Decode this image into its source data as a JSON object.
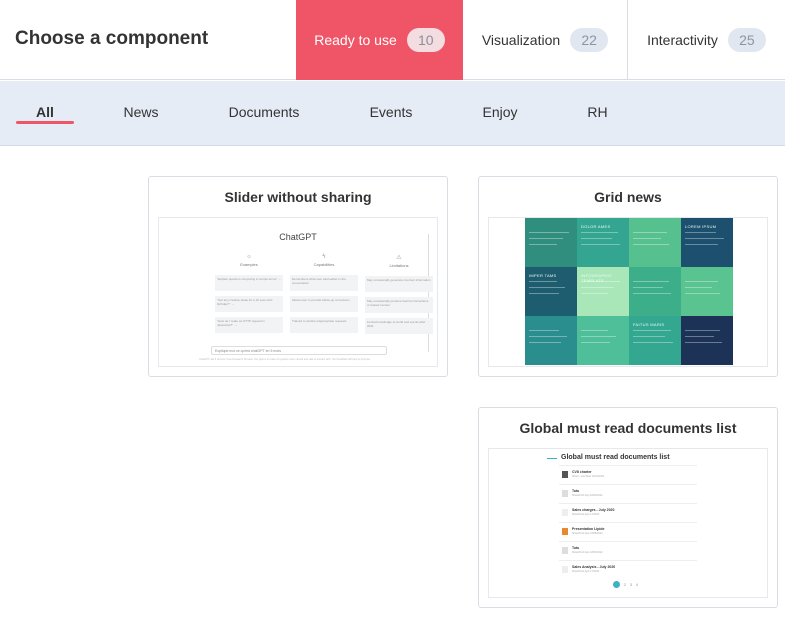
{
  "header": {
    "title": "Choose a component",
    "tabs": [
      {
        "label": "Ready to use",
        "count": "10",
        "active": true
      },
      {
        "label": "Visualization",
        "count": "22",
        "active": false
      },
      {
        "label": "Interactivity",
        "count": "25",
        "active": false
      }
    ]
  },
  "filters": [
    {
      "label": "All",
      "active": true
    },
    {
      "label": "News",
      "active": false
    },
    {
      "label": "Documents",
      "active": false
    },
    {
      "label": "Events",
      "active": false
    },
    {
      "label": "Enjoy",
      "active": false
    },
    {
      "label": "RH",
      "active": false
    }
  ],
  "cards": [
    {
      "title": "Slider without sharing",
      "preview": {
        "app_title": "ChatGPT",
        "columns": [
          {
            "heading": "Examples",
            "icon": "sun-icon",
            "items": [
              "\"Explain quantum computing in simple terms\" →",
              "\"Got any creative ideas for a 10 year old's birthday?\" →",
              "\"How do I make an HTTP request in Javascript?\" →"
            ]
          },
          {
            "heading": "Capabilities",
            "icon": "lightning-icon",
            "items": [
              "Remembers what user said earlier in the conversation",
              "Allows user to provide follow-up corrections",
              "Trained to decline inappropriate requests"
            ]
          },
          {
            "heading": "Limitations",
            "icon": "warning-icon",
            "items": [
              "May occasionally generate incorrect information",
              "May occasionally produce harmful instructions or biased content",
              "Limited knowledge of world and events after 2021"
            ]
          }
        ],
        "input_text": "Explique moi ce qu'est chatGPT en 5 mots",
        "footer": "ChatGPT Jan 9 Version. Free Research Preview. Our goal is to make AI systems more natural and safe to interact with. Your feedback will help us improve."
      }
    },
    {
      "title": "Grid news",
      "preview": {
        "tiles": [
          "",
          "DOLOR AMES",
          "",
          "LOREM IPSUM",
          "IMPER TAMS",
          "INFOGRAPHIC TEMPLATE",
          "",
          "",
          "",
          "",
          "FAITUS MARIS",
          ""
        ],
        "tile_colors": [
          "#2f8e7e",
          "#34a590",
          "#56c08f",
          "#1d4f6e",
          "#1e5c70",
          "#a9e6b8",
          "#3cae8a",
          "#59c48f",
          "#2a8d8e",
          "#4fbf99",
          "#33a78f",
          "#1c3357"
        ]
      }
    },
    {
      "title": "Global must read documents list",
      "preview": {
        "list_title": "Global must read documents list",
        "items": [
          {
            "name": "CV8 charter",
            "meta": "Alfred · Last Mod 12/01/2022"
          },
          {
            "name": "Tutu",
            "meta": "SharePoint App 18/03/2022"
          },
          {
            "name": "Sales charges - July 2020",
            "meta": "SharePoint App 17/2020"
          },
          {
            "name": "Presentation Lipide",
            "meta": "SharePoint App 23/08/2022"
          },
          {
            "name": "Tutu",
            "meta": "SharePoint App 18/03/2022"
          },
          {
            "name": "Sales Analysis - July 2020",
            "meta": "SharePoint App 17/2020"
          }
        ],
        "pager": [
          "1",
          "2",
          "3",
          "4"
        ]
      }
    }
  ],
  "colors": {
    "accent": "#ef5566",
    "filter_bg": "#e6ecf6",
    "teal": "#3bb3c3"
  }
}
